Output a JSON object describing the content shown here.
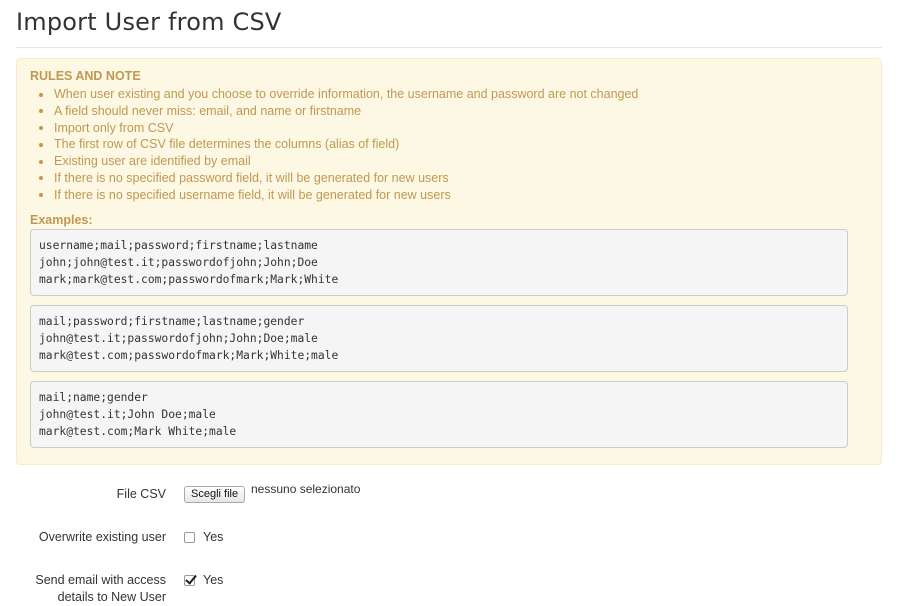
{
  "page": {
    "title": "Import User from CSV"
  },
  "rules": {
    "heading": "RULES AND NOTE",
    "items": [
      "When user existing and you choose to override information, the username and password are not changed",
      "A field should never miss: email, and name or firstname",
      "Import only from CSV",
      "The first row of CSV file determines the columns (alias of field)",
      "Existing user are identified by email",
      "If there is no specified password field, it will be generated for new users",
      "If there is no specified username field, it will be generated for new users"
    ],
    "examples_heading": "Examples:",
    "examples": [
      [
        "username;mail;password;firstname;lastname",
        "john;john@test.it;passwordofjohn;John;Doe",
        "mark;mark@test.com;passwordofmark;Mark;White"
      ],
      [
        "mail;password;firstname;lastname;gender",
        "john@test.it;passwordofjohn;John;Doe;male",
        "mark@test.com;passwordofmark;Mark;White;male"
      ],
      [
        "mail;name;gender",
        "john@test.it;John Doe;male",
        "mark@test.com;Mark White;male"
      ]
    ]
  },
  "form": {
    "file": {
      "label": "File CSV",
      "button_label": "Scegli file",
      "status": "nessuno selezionato"
    },
    "overwrite": {
      "label": "Overwrite existing user",
      "option_label": "Yes",
      "checked": false
    },
    "send_email": {
      "label": "Send email with access details to New User",
      "option_label": "Yes",
      "checked": true
    }
  },
  "colors": {
    "warning_background": "#fcf8e3",
    "warning_border": "#faebcc",
    "warning_text": "#c09853",
    "code_background": "#f5f5f5"
  }
}
